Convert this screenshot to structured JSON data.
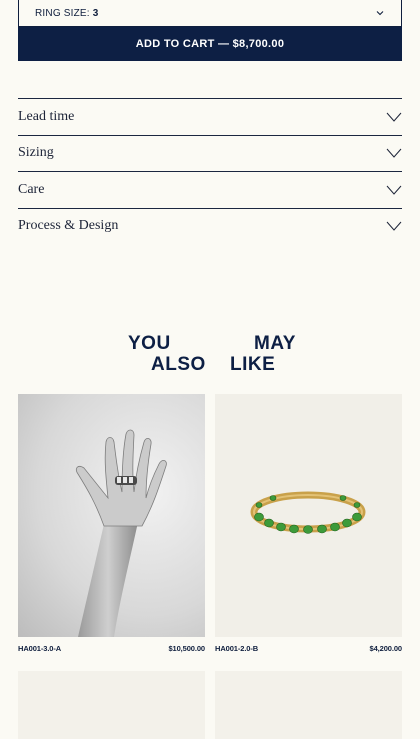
{
  "ring_size": {
    "label": "RING SIZE:",
    "value": "3"
  },
  "cart_button": "ADD TO CART — $8,700.00",
  "accordion": [
    {
      "label": "Lead time"
    },
    {
      "label": "Sizing"
    },
    {
      "label": "Care"
    },
    {
      "label": "Process & Design"
    }
  ],
  "recommendations": {
    "heading_words": [
      "YOU",
      "MAY",
      "ALSO",
      "LIKE"
    ],
    "products": [
      {
        "sku": "HA001-3.0-A",
        "price": "$10,500.00"
      },
      {
        "sku": "HA001-2.0-B",
        "price": "$4,200.00"
      }
    ]
  },
  "colors": {
    "navy": "#0d1f44",
    "background": "#fbfaf4"
  }
}
